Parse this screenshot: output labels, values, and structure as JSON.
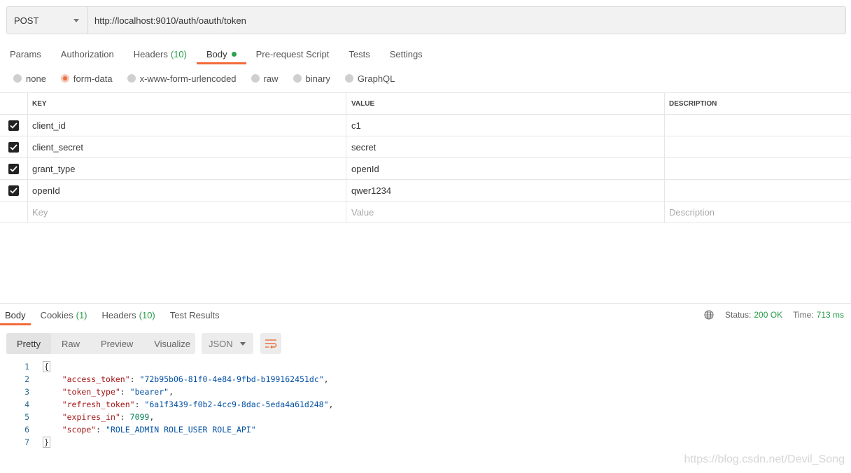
{
  "request": {
    "method": "POST",
    "url": "http://localhost:9010/auth/oauth/token"
  },
  "request_tabs": [
    {
      "label": "Params",
      "count": ""
    },
    {
      "label": "Authorization",
      "count": ""
    },
    {
      "label": "Headers",
      "count": "(10)"
    },
    {
      "label": "Body",
      "count": ""
    },
    {
      "label": "Pre-request Script",
      "count": ""
    },
    {
      "label": "Tests",
      "count": ""
    },
    {
      "label": "Settings",
      "count": ""
    }
  ],
  "active_request_tab": "Body",
  "body_types": [
    "none",
    "form-data",
    "x-www-form-urlencoded",
    "raw",
    "binary",
    "GraphQL"
  ],
  "selected_body_type": "form-data",
  "params_table": {
    "headers": {
      "key": "KEY",
      "value": "VALUE",
      "description": "DESCRIPTION"
    },
    "rows": [
      {
        "checked": true,
        "key": "client_id",
        "value": "c1",
        "description": ""
      },
      {
        "checked": true,
        "key": "client_secret",
        "value": "secret",
        "description": ""
      },
      {
        "checked": true,
        "key": "grant_type",
        "value": "openId",
        "description": ""
      },
      {
        "checked": true,
        "key": "openId",
        "value": "qwer1234",
        "description": ""
      }
    ],
    "placeholders": {
      "key": "Key",
      "value": "Value",
      "description": "Description"
    }
  },
  "response_tabs": [
    {
      "label": "Body",
      "count": ""
    },
    {
      "label": "Cookies",
      "count": "(1)"
    },
    {
      "label": "Headers",
      "count": "(10)"
    },
    {
      "label": "Test Results",
      "count": ""
    }
  ],
  "status": {
    "status_label": "Status:",
    "status_value": "200 OK",
    "time_label": "Time:",
    "time_value": "713 ms"
  },
  "view_modes": [
    "Pretty",
    "Raw",
    "Preview",
    "Visualize"
  ],
  "active_view_mode": "Pretty",
  "format": "JSON",
  "response_json": {
    "access_token": "72b95b06-81f0-4e84-9fbd-b199162451dc",
    "token_type": "bearer",
    "refresh_token": "6a1f3439-f0b2-4cc9-8dac-5eda4a61d248",
    "expires_in": "7099",
    "scope": "ROLE_ADMIN ROLE_USER ROLE_API"
  },
  "line_numbers": [
    "1",
    "2",
    "3",
    "4",
    "5",
    "6",
    "7"
  ],
  "watermark": "https://blog.csdn.net/Devil_Song",
  "colors": {
    "accent": "#f26b3a",
    "success": "#2a9d4a",
    "json_key": "#a31515",
    "json_string": "#0451a5"
  }
}
